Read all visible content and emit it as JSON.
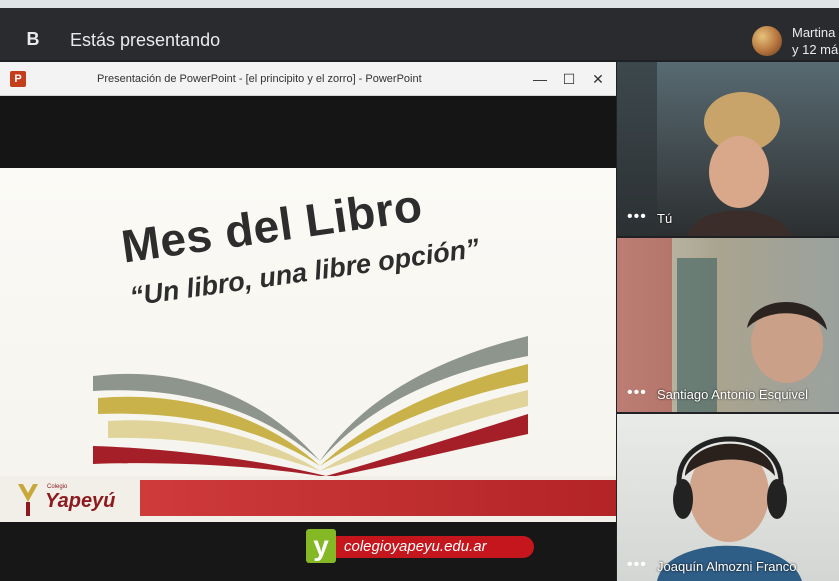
{
  "meet": {
    "presenter_initial": "B",
    "presenting_label": "Estás presentando",
    "participant_name": "Martina",
    "participant_more": "y 12 má"
  },
  "ppt": {
    "app_letter": "P",
    "window_title": "Presentación de PowerPoint - [el principito y el zorro] - PowerPoint",
    "minimize_glyph": "—",
    "maximize_glyph": "☐",
    "close_glyph": "✕"
  },
  "slide": {
    "title": "Mes del Libro",
    "subtitle": "“Un libro, una libre opción”",
    "school_small": "Colegio",
    "school_name": "Yapeyú"
  },
  "tiles": [
    {
      "name": "Tú",
      "menu": "•••"
    },
    {
      "name": "Santiago Antonio Esquivel",
      "menu": "•••"
    },
    {
      "name": "Joaquín Almozni Franco",
      "menu": "•••"
    }
  ],
  "watermark": {
    "letter": "y",
    "url": "colegioyapeyu.edu.ar"
  },
  "colors": {
    "meet_bg": "#202124",
    "ppt_accent": "#c43e1c",
    "book_gray": "#8e958c",
    "book_olive": "#c9b24a",
    "book_red": "#a51f28",
    "watermark_green": "#84b925",
    "watermark_red": "#c4161c"
  }
}
